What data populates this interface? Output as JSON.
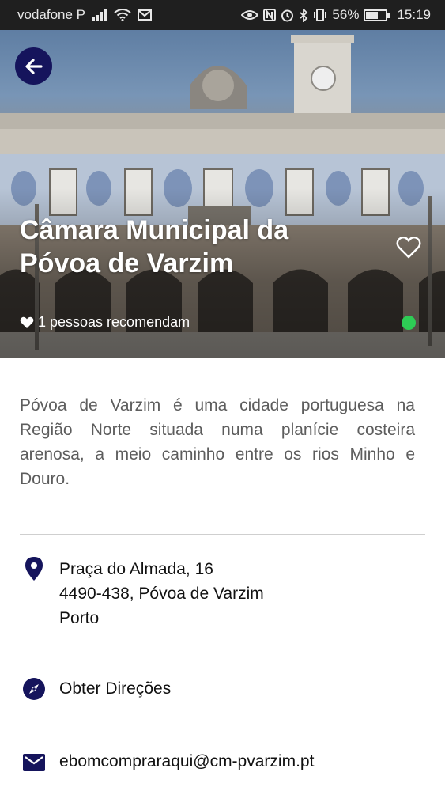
{
  "status_bar": {
    "carrier": "vodafone P",
    "battery": "56%",
    "time": "15:19"
  },
  "hero": {
    "title": "Câmara Municipal da Póvoa de Varzim",
    "recommend_text": "1 pessoas recomendam",
    "open_status_color": "#2ecc55"
  },
  "description": "Póvoa de Varzim é uma cidade portuguesa na Região Norte situada numa planície costeira arenosa, a meio caminho entre os rios Minho e Douro.",
  "address": {
    "line1": "Praça do Almada, 16",
    "line2": "4490-438, Póvoa de Varzim",
    "line3": "Porto"
  },
  "directions_label": "Obter Direções",
  "email": "ebomcompraraqui@cm-pvarzim.pt",
  "colors": {
    "accent": "#15145c",
    "status_bar": "#1f1f1f",
    "text_muted": "#5d5d5d"
  },
  "icons": [
    "back-arrow-icon",
    "heart-outline-icon",
    "heart-icon",
    "location-pin-icon",
    "compass-icon",
    "mail-icon"
  ]
}
